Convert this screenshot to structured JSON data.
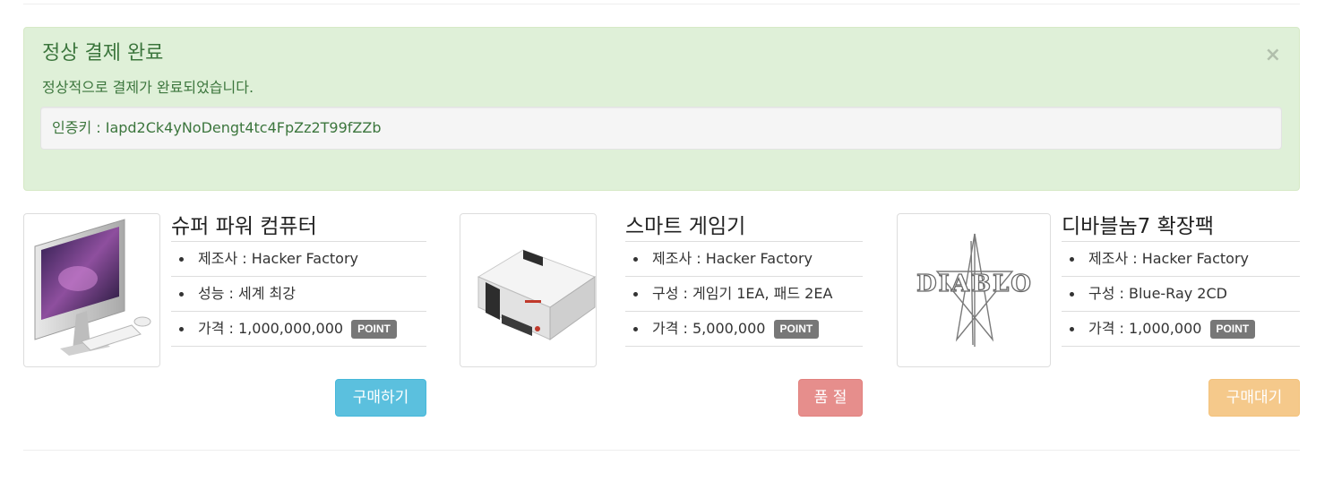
{
  "alert": {
    "title": "정상 결제 완료",
    "message": "정상적으로 결제가 완료되었습니다.",
    "close_symbol": "×",
    "auth_key_text": "인증키 : Iapd2Ck4yNoDengt4tc4FpZz2T99fZZb"
  },
  "products": [
    {
      "title": "슈퍼 파워 컴퓨터",
      "specs": [
        "제조사 : Hacker Factory",
        "성능 : 세계 최강"
      ],
      "price_text": "가격 : 1,000,000,000",
      "price_badge": "POINT",
      "button_label": "구매하기",
      "button_status": "available",
      "image_icon": "imac-computer-icon"
    },
    {
      "title": "스마트 게임기",
      "specs": [
        "제조사 : Hacker Factory",
        "구성 : 게임기 1EA, 패드 2EA"
      ],
      "price_text": "가격 : 5,000,000",
      "price_badge": "POINT",
      "button_label": "품 절",
      "button_status": "sold-out",
      "image_icon": "game-console-icon"
    },
    {
      "title": "디바블놈7 확장팩",
      "specs": [
        "제조사 : Hacker Factory",
        "구성 : Blue-Ray 2CD"
      ],
      "price_text": "가격 : 1,000,000",
      "price_badge": "POINT",
      "button_label": "구매대기",
      "button_status": "waiting",
      "image_icon": "diablo-logo-icon"
    }
  ],
  "colors": {
    "alert_bg": "#dff0d8",
    "alert_text": "#3c763d",
    "btn_info": "#5bc0de",
    "btn_danger": "#d9534f",
    "btn_warning": "#f0ad4e",
    "badge": "#777777"
  }
}
